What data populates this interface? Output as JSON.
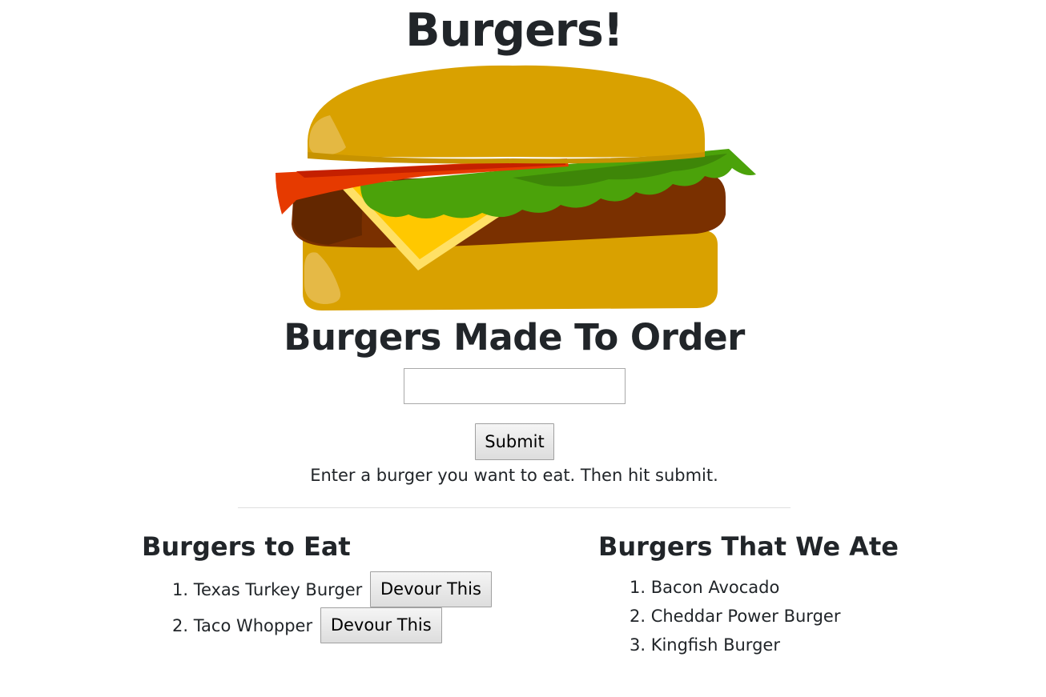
{
  "header": {
    "title": "Burgers!"
  },
  "image": {
    "icon": "burger-icon"
  },
  "order": {
    "heading": "Burgers Made To Order",
    "input_value": "",
    "input_placeholder": "",
    "submit_label": "Submit",
    "instructions": "Enter a burger you want to eat. Then hit submit."
  },
  "to_eat": {
    "heading": "Burgers to Eat",
    "items": [
      {
        "number": "1.",
        "name": "Texas Turkey Burger",
        "button_label": "Devour This"
      },
      {
        "number": "2.",
        "name": "Taco Whopper",
        "button_label": "Devour This"
      }
    ]
  },
  "eaten": {
    "heading": "Burgers That We Ate",
    "items": [
      {
        "number": "1.",
        "name": "Bacon Avocado"
      },
      {
        "number": "2.",
        "name": "Cheddar Power Burger"
      },
      {
        "number": "3.",
        "name": "Kingfish Burger"
      }
    ]
  },
  "colors": {
    "text": "#212529",
    "bun": "#d9a100",
    "lettuce": "#4ba20a",
    "tomato": "#e63a00",
    "patty": "#6e2a00",
    "cheese": "#ffc800"
  }
}
